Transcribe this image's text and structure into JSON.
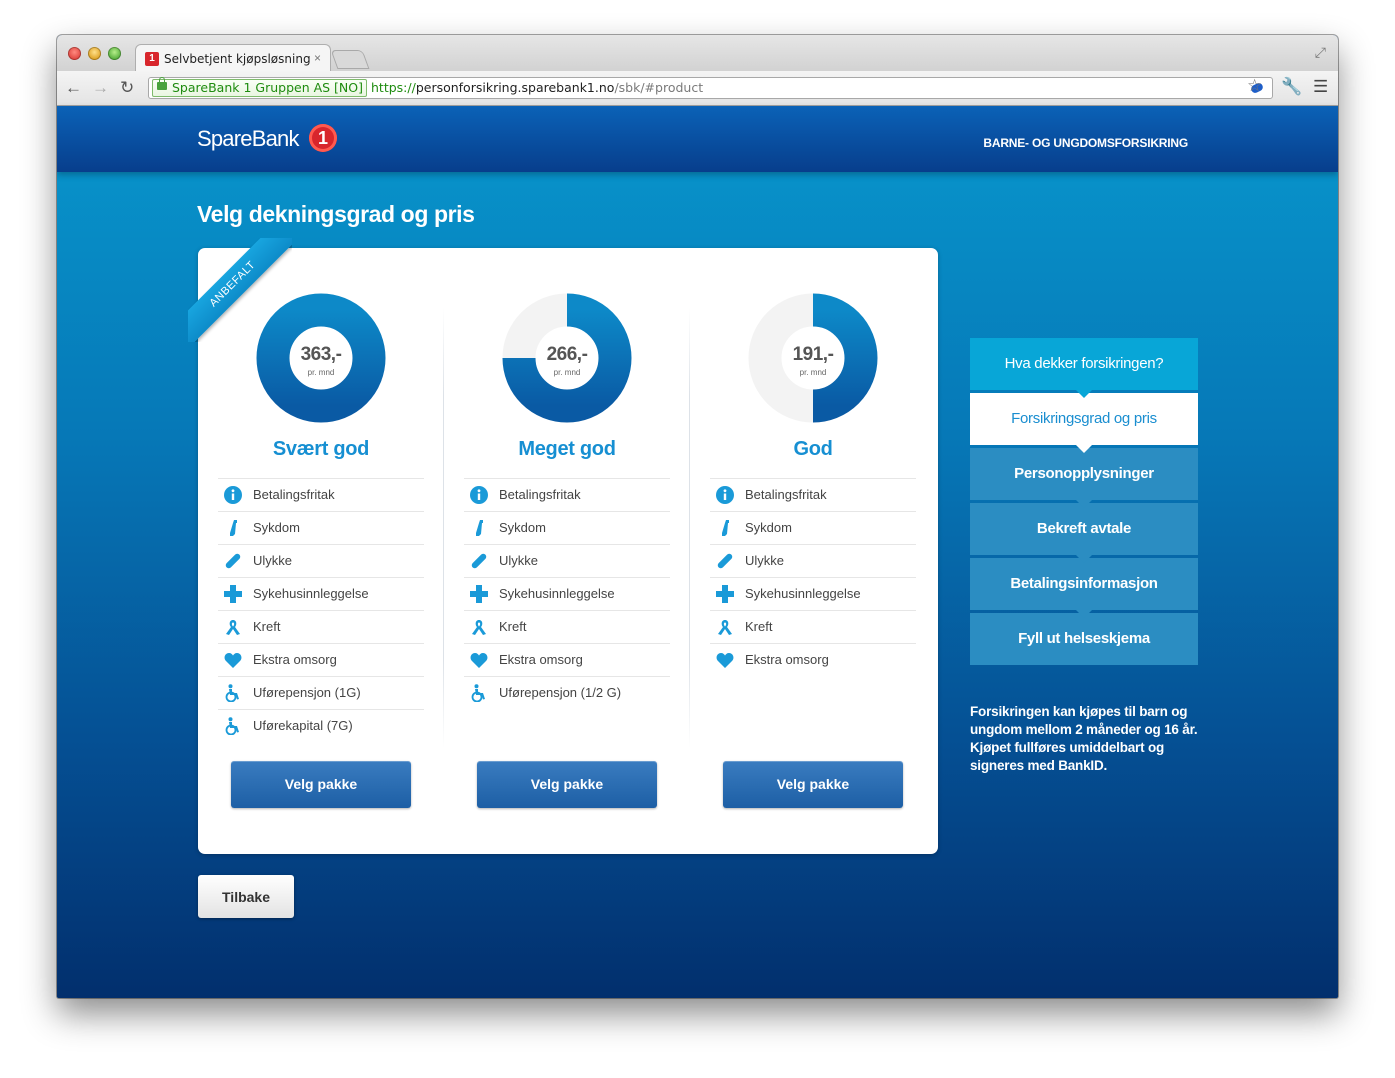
{
  "browser": {
    "tab_title": "Selvbetjent kjøpsløsning",
    "tab_close": "×",
    "ev_label": "SpareBank 1 Gruppen AS [NO]",
    "url_scheme": "https://",
    "url_host": "personforsikring.sparebank1.no",
    "url_path": "/sbk/#product"
  },
  "header": {
    "logo_text": "SpareBank",
    "logo_mark": "1",
    "nav_title": "BARNE- OG UNGDOMSFORSIKRING"
  },
  "page_title": "Velg dekningsgrad og pris",
  "ribbon": "ANBEFALT",
  "plans": [
    {
      "price": "363,-",
      "per_month": "pr. mnd",
      "name": "Svært god",
      "coverage_fraction": 1.0,
      "features": [
        {
          "icon": "info-icon",
          "label": "Betalingsfritak"
        },
        {
          "icon": "syringe-icon",
          "label": "Sykdom"
        },
        {
          "icon": "bandage-icon",
          "label": "Ulykke"
        },
        {
          "icon": "cross-icon",
          "label": "Sykehusinnleggelse"
        },
        {
          "icon": "ribbon-icon",
          "label": "Kreft"
        },
        {
          "icon": "heart-icon",
          "label": "Ekstra omsorg"
        },
        {
          "icon": "wheelchair-icon",
          "label": "Uførepensjon (1G)"
        },
        {
          "icon": "wheelchair-icon",
          "label": "Uførekapital (7G)"
        }
      ],
      "button": "Velg pakke"
    },
    {
      "price": "266,-",
      "per_month": "pr. mnd",
      "name": "Meget god",
      "coverage_fraction": 0.75,
      "features": [
        {
          "icon": "info-icon",
          "label": "Betalingsfritak"
        },
        {
          "icon": "syringe-icon",
          "label": "Sykdom"
        },
        {
          "icon": "bandage-icon",
          "label": "Ulykke"
        },
        {
          "icon": "cross-icon",
          "label": "Sykehusinnleggelse"
        },
        {
          "icon": "ribbon-icon",
          "label": "Kreft"
        },
        {
          "icon": "heart-icon",
          "label": "Ekstra omsorg"
        },
        {
          "icon": "wheelchair-icon",
          "label": "Uførepensjon (1/2 G)"
        }
      ],
      "button": "Velg pakke"
    },
    {
      "price": "191,-",
      "per_month": "pr. mnd",
      "name": "God",
      "coverage_fraction": 0.5,
      "features": [
        {
          "icon": "info-icon",
          "label": "Betalingsfritak"
        },
        {
          "icon": "syringe-icon",
          "label": "Sykdom"
        },
        {
          "icon": "bandage-icon",
          "label": "Ulykke"
        },
        {
          "icon": "cross-icon",
          "label": "Sykehusinnleggelse"
        },
        {
          "icon": "ribbon-icon",
          "label": "Kreft"
        },
        {
          "icon": "heart-icon",
          "label": "Ekstra omsorg"
        }
      ],
      "button": "Velg pakke"
    }
  ],
  "back_button": "Tilbake",
  "steps": [
    {
      "label": "Hva dekker forsikringen?",
      "state": "done"
    },
    {
      "label": "Forsikringsgrad og pris",
      "state": "active"
    },
    {
      "label": "Personopplysninger",
      "state": "todo"
    },
    {
      "label": "Bekreft avtale",
      "state": "todo"
    },
    {
      "label": "Betalingsinformasjon",
      "state": "todo"
    },
    {
      "label": "Fyll ut helseskjema",
      "state": "todo"
    }
  ],
  "info_text": "Forsikringen kan kjøpes til barn og ungdom mellom 2 måneder og 16 år. Kjøpet fullføres umiddelbart og signeres med BankID.",
  "colors": {
    "accent": "#168fd2",
    "donut_fill": "#0a6fb5",
    "donut_track": "#f3f3f3",
    "icon": "#1a9ad8"
  }
}
